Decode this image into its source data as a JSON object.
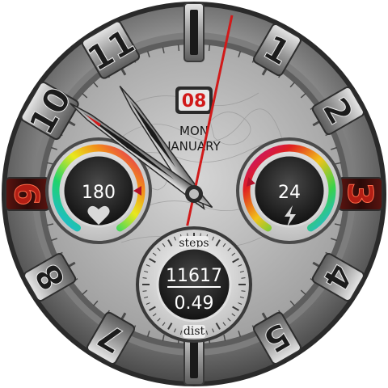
{
  "watch": {
    "numerals": [
      "1",
      "2",
      "3",
      "4",
      "5",
      "7",
      "8",
      "9",
      "10",
      "11"
    ],
    "date": {
      "day": "08",
      "weekday": "MON",
      "month": "JANUARY"
    },
    "time": {
      "hours": 10,
      "minutes": 51,
      "seconds": 2
    },
    "heart_rate": {
      "value": "180",
      "icon": "heart-icon",
      "level": 0.8
    },
    "battery": {
      "value": "24",
      "icon": "lightning-icon",
      "level": 0.24
    },
    "counter": {
      "top_label": "steps",
      "bottom_label": "dist",
      "steps": "11617",
      "distance": "0.49"
    },
    "colors": {
      "accent_red": "#d11a1a",
      "dial_silver": "#9a9a9a",
      "numeral_red": "#b21e14"
    }
  }
}
